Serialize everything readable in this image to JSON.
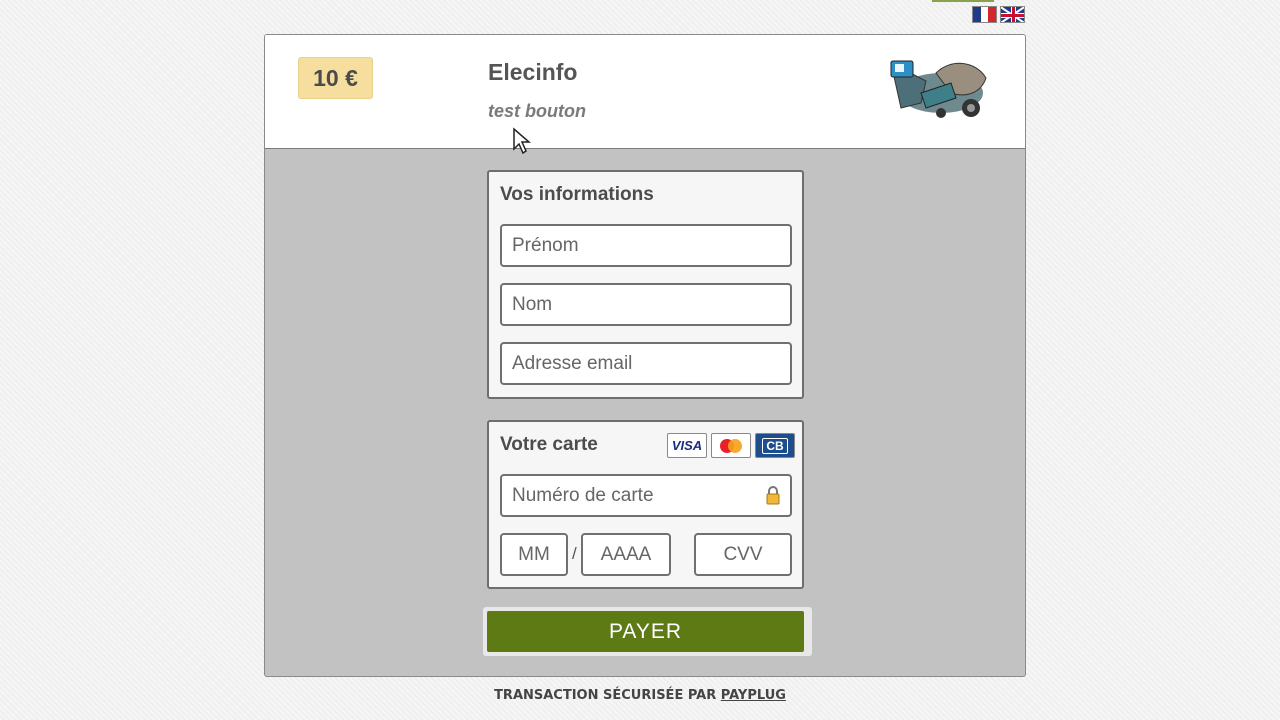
{
  "header": {
    "amount": "10 €",
    "merchant_name": "Elecinfo",
    "tagline": "test bouton",
    "logo_icon": "merchant-logo-icon"
  },
  "languages": [
    {
      "code": "fr",
      "icon": "france-flag-icon"
    },
    {
      "code": "en",
      "icon": "uk-flag-icon"
    }
  ],
  "info_section": {
    "title": "Vos informations",
    "first_name_placeholder": "Prénom",
    "last_name_placeholder": "Nom",
    "email_placeholder": "Adresse email"
  },
  "card_section": {
    "title": "Votre carte",
    "card_logos": [
      "VISA",
      "MasterCard",
      "CB"
    ],
    "card_number_placeholder": "Numéro de carte",
    "month_placeholder": "MM",
    "separator": "/",
    "year_placeholder": "AAAA",
    "cvv_placeholder": "CVV"
  },
  "pay_button": "PAYER",
  "footer": {
    "text": "TRANSACTION SÉCURISÉE PAR ",
    "link": "PAYPLUG"
  },
  "colors": {
    "pay_button": "#5e7a15",
    "amount_badge": "#f6df9e",
    "form_background": "#c2c2c2"
  }
}
